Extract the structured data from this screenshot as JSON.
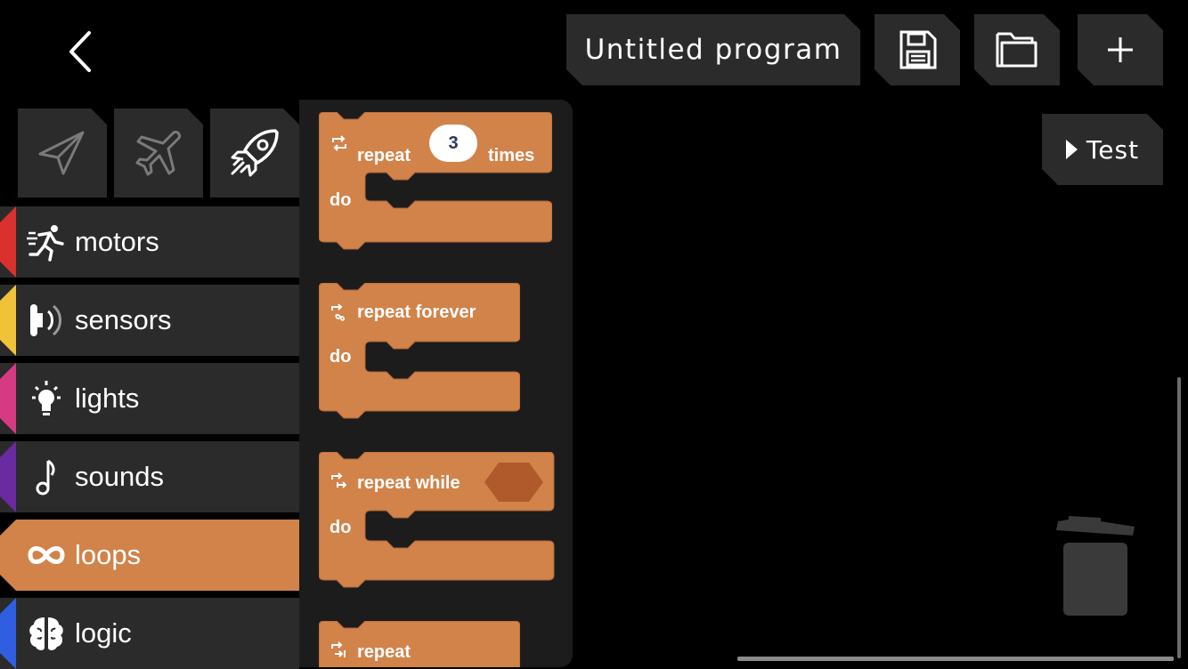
{
  "header": {
    "back_icon": "chevron-left-icon",
    "program_title": "Untitled program",
    "save_icon": "floppy-disk-icon",
    "open_icon": "folder-icon",
    "new_icon": "plus-icon"
  },
  "test_button": {
    "label": "Test",
    "icon": "play-triangle-icon"
  },
  "sprites": [
    {
      "icon": "paper-plane-icon"
    },
    {
      "icon": "airplane-icon"
    },
    {
      "icon": "rocket-icon",
      "selected": true
    }
  ],
  "categories": [
    {
      "label": "motors",
      "color": "#d8312e",
      "icon": "running-person-icon"
    },
    {
      "label": "sensors",
      "color": "#f0c23a",
      "icon": "sensor-icon"
    },
    {
      "label": "lights",
      "color": "#d63a82",
      "icon": "lightbulb-icon"
    },
    {
      "label": "sounds",
      "color": "#6a2aa0",
      "icon": "music-note-icon"
    },
    {
      "label": "loops",
      "color": "#d1834a",
      "icon": "infinity-icon",
      "active": true
    },
    {
      "label": "logic",
      "color": "#2f5fe0",
      "icon": "brain-icon"
    }
  ],
  "blocks": {
    "repeat_times": {
      "word1": "repeat",
      "count": "3",
      "word2": "times",
      "do": "do"
    },
    "repeat_forever": {
      "label": "repeat forever",
      "do": "do"
    },
    "repeat_while": {
      "label": "repeat while",
      "do": "do"
    },
    "repeat_until": {
      "label": "repeat"
    }
  },
  "colors": {
    "block": "#d1834a",
    "block_edge": "#b0643a",
    "panel": "#2b2b2b",
    "flyout": "#1c1c1c"
  }
}
